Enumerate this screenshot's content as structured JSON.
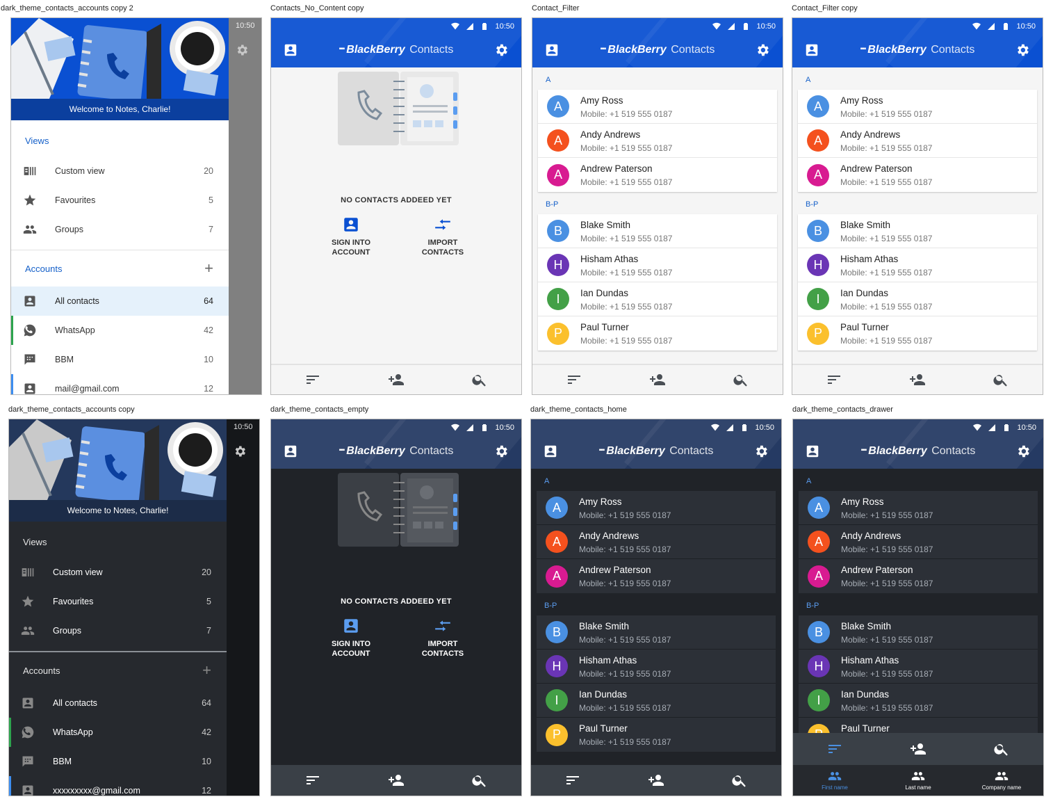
{
  "brand": {
    "name": "BlackBerry",
    "product": "Contacts"
  },
  "status_time": "10:50",
  "artboards": [
    "dark_theme_contacts_accounts copy 2",
    "Contacts_No_Content copy",
    "Contact_Filter",
    "Contact_Filter copy",
    "dark_theme_contacts_accounts copy",
    "dark_theme_contacts_empty",
    "dark_theme_contacts_home",
    "dark_theme_contacts_drawer"
  ],
  "drawer": {
    "welcome": "Welcome  to Notes, Charlie!",
    "views_label": "Views",
    "views": [
      {
        "label": "Custom view",
        "count": "20",
        "icon": "view-list-icon"
      },
      {
        "label": "Favourites",
        "count": "5",
        "icon": "star-icon"
      },
      {
        "label": "Groups",
        "count": "7",
        "icon": "group-icon"
      }
    ],
    "accounts_label": "Accounts",
    "accounts_add": "+",
    "accounts": [
      {
        "label": "All contacts",
        "count": "64",
        "icon": "contacts-icon"
      },
      {
        "label": "WhatsApp",
        "count": "42",
        "icon": "whatsapp-icon"
      },
      {
        "label": "BBM",
        "count": "10",
        "icon": "bbm-icon"
      },
      {
        "label": "mail@gmail.com",
        "count": "12",
        "icon": "account-icon"
      }
    ],
    "dark_last_account": "xxxxxxxxx@gmail.com"
  },
  "contacts": {
    "sections": [
      {
        "label": "A",
        "items": [
          {
            "initial": "A",
            "name": "Amy Ross",
            "phone": "Mobile: +1 519 555 0187",
            "color": "#4a90e2"
          },
          {
            "initial": "A",
            "name": "Andy Andrews",
            "phone": "Mobile: +1 519 555 0187",
            "color": "#f4511e"
          },
          {
            "initial": "A",
            "name": "Andrew Paterson",
            "phone": "Mobile: +1 519 555 0187",
            "color": "#d81b91"
          }
        ]
      },
      {
        "label": "B-P",
        "items": [
          {
            "initial": "B",
            "name": "Blake Smith",
            "phone": "Mobile: +1 519 555 0187",
            "color": "#4a90e2"
          },
          {
            "initial": "H",
            "name": "Hisham Athas",
            "phone": "Mobile: +1 519 555 0187",
            "color": "#6a35b5"
          },
          {
            "initial": "I",
            "name": "Ian Dundas",
            "phone": "Mobile: +1 519 555 0187",
            "color": "#43a047"
          },
          {
            "initial": "P",
            "name": "Paul Turner",
            "phone": "Mobile: +1 519 555 0187",
            "color": "#fbc02d"
          }
        ]
      }
    ]
  },
  "empty": {
    "title": "NO CONTACTS ADDEED YET",
    "sign_in": [
      "SIGN INTO",
      "ACCOUNT"
    ],
    "import": [
      "IMPORT",
      "CONTACTS"
    ]
  },
  "sort": {
    "options": [
      "First name",
      "Last name",
      "Company name"
    ]
  },
  "colors": {
    "primary": "#0a50d2",
    "dark_bg": "#202328",
    "dark_appbar": "#253a63",
    "accent": "#4a90e2"
  }
}
